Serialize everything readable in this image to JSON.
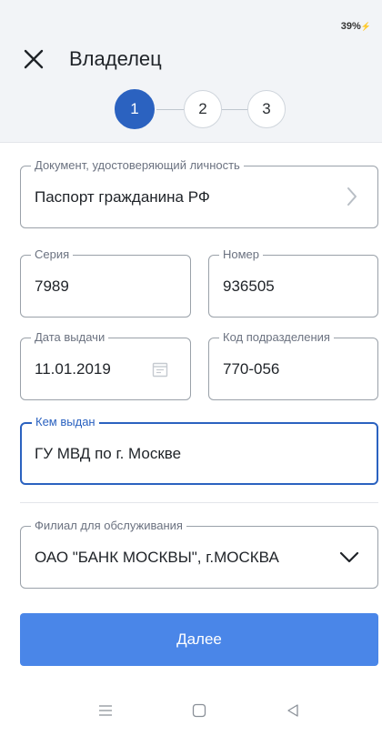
{
  "status": {
    "battery": "39%"
  },
  "header": {
    "title": "Владелец"
  },
  "stepper": {
    "steps": [
      "1",
      "2",
      "3"
    ]
  },
  "form": {
    "document": {
      "label": "Документ, удостоверяющий личность",
      "value": "Паспорт гражданина РФ"
    },
    "series": {
      "label": "Серия",
      "value": "7989"
    },
    "number": {
      "label": "Номер",
      "value": "936505"
    },
    "issue_date": {
      "label": "Дата выдачи",
      "value": "11.01.2019"
    },
    "division_code": {
      "label": "Код подразделения",
      "value": "770-056"
    },
    "issued_by": {
      "label": "Кем выдан",
      "value": "ГУ МВД по г. Москве"
    },
    "branch": {
      "label": "Филиал для обслуживания",
      "value": "ОАО \"БАНК МОСКВЫ\", г.МОСКВА"
    }
  },
  "actions": {
    "next": "Далее"
  },
  "colors": {
    "accent": "#2b62c0",
    "button": "#4a86e8"
  }
}
